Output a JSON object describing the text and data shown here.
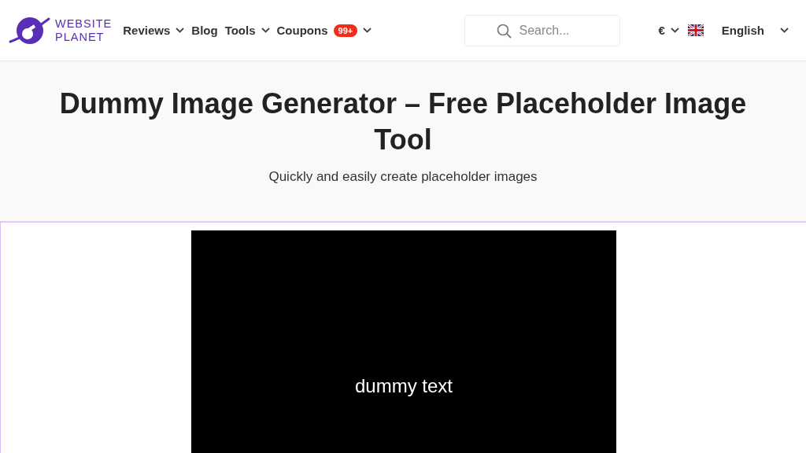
{
  "logo": {
    "line_1": "WEBSITE",
    "line_2": "PLANET"
  },
  "nav": [
    {
      "label": "Reviews",
      "dropdown": true
    },
    {
      "label": "Blog",
      "dropdown": false
    },
    {
      "label": "Tools",
      "dropdown": true
    },
    {
      "label": "Coupons",
      "badge": "99+",
      "dropdown": true
    }
  ],
  "search": {
    "placeholder": "Search..."
  },
  "currency": {
    "label": "€"
  },
  "language": {
    "label": "English"
  },
  "hero": {
    "title": "Dummy Image Generator – Free Placeholder Image Tool",
    "subtitle": "Quickly and easily create placeholder images"
  },
  "preview": {
    "text": "dummy text"
  }
}
